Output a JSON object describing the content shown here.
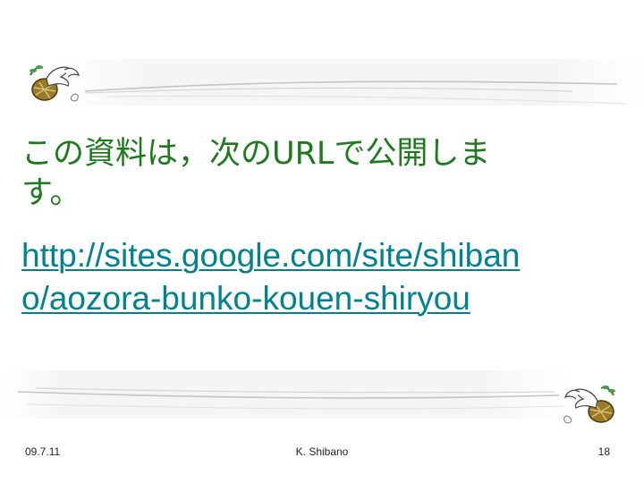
{
  "body": {
    "line1": "この資料は，次のURLで公開しま",
    "line2": "す。"
  },
  "link": {
    "line1": "http://sites.google.com/site/shiban",
    "line2": "o/aozora-bunko-kouen-shiryou"
  },
  "footer": {
    "date": "09.7.11",
    "author": "K. Shibano",
    "page": "18"
  },
  "decoration": {
    "top_icon": "dove-with-olive-branch-icon",
    "bottom_icon": "dove-with-olive-branch-icon"
  },
  "colors": {
    "body_text": "#1d7a1d",
    "link_text": "#00838f",
    "swoosh": "#b8b8b8"
  }
}
